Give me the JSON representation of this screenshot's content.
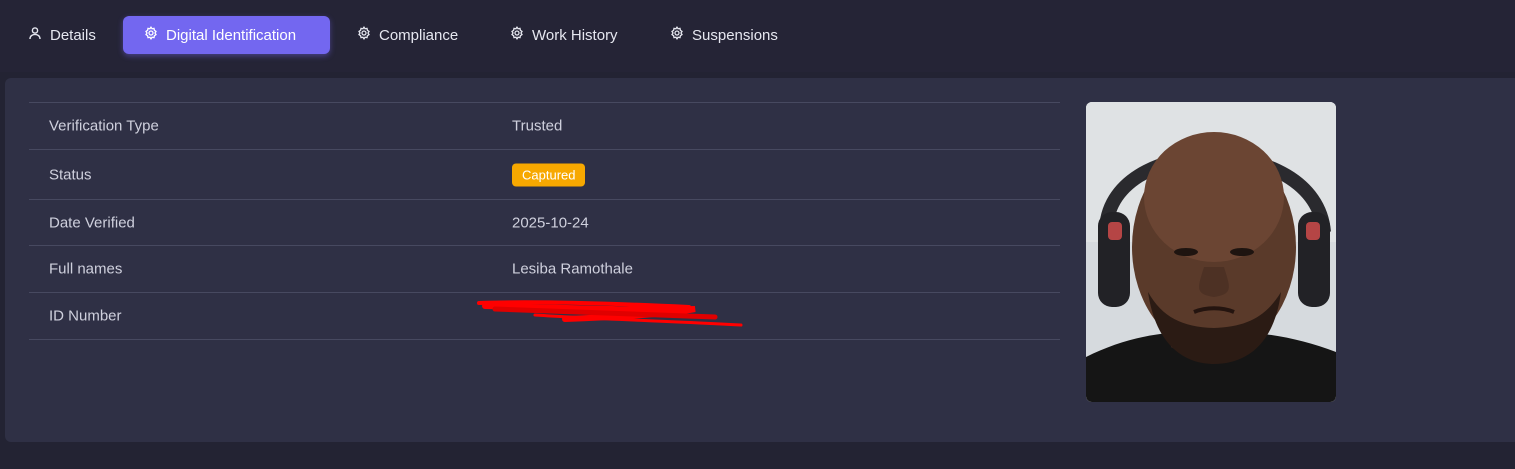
{
  "tabs": [
    {
      "label": "Details",
      "icon": "user-icon",
      "active": false
    },
    {
      "label": "Digital Identification",
      "icon": "gear-icon",
      "active": true
    },
    {
      "label": "Compliance",
      "icon": "gear-icon",
      "active": false
    },
    {
      "label": "Work History",
      "icon": "gear-icon",
      "active": false
    },
    {
      "label": "Suspensions",
      "icon": "gear-icon",
      "active": false
    }
  ],
  "details": {
    "verification_type": {
      "label": "Verification Type",
      "value": "Trusted"
    },
    "status": {
      "label": "Status",
      "value": "Captured",
      "badge_color": "#f7a800"
    },
    "date_verified": {
      "label": "Date Verified",
      "value": "2025-10-24"
    },
    "full_names": {
      "label": "Full names",
      "value": "Lesiba Ramothale"
    },
    "id_number": {
      "label": "ID Number",
      "redacted": true
    }
  },
  "colors": {
    "accent": "#7367f0",
    "background": "#232333",
    "card": "#2f3045",
    "redaction": "#ff0000"
  }
}
